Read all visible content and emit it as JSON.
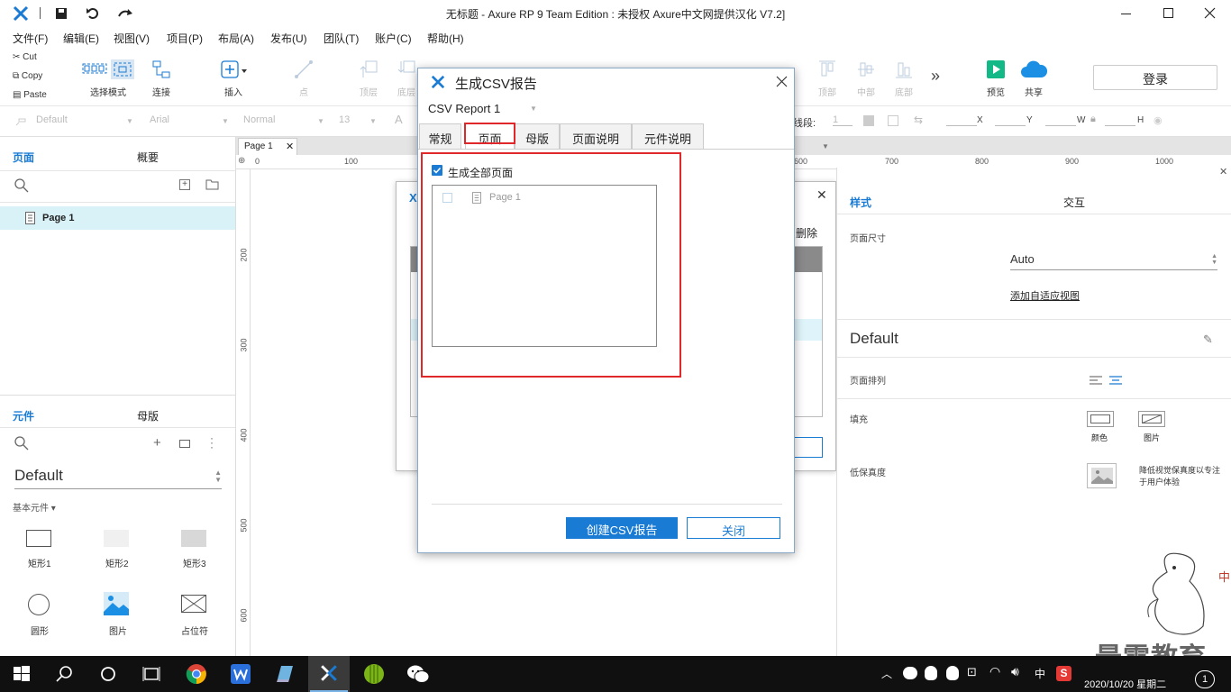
{
  "window": {
    "title": "无标题 - Axure RP 9 Team Edition : 未授权    Axure中文网提供汉化 V7.2]"
  },
  "menu": [
    "文件(F)",
    "编辑(E)",
    "视图(V)",
    "项目(P)",
    "布局(A)",
    "发布(U)",
    "团队(T)",
    "账户(C)",
    "帮助(H)"
  ],
  "clipboard": {
    "cut": "Cut",
    "copy": "Copy",
    "paste": "Paste"
  },
  "toolbar": {
    "select_mode": "选择模式",
    "connect": "连接",
    "insert": "插入",
    "point": "点",
    "top_layer": "顶层",
    "bottom_layer": "底层",
    "align_top": "顶部",
    "align_middle": "中部",
    "align_bottom": "底部",
    "more": "»",
    "preview": "预览",
    "share": "共享",
    "login": "登录"
  },
  "stylebar": {
    "style": "Default",
    "font": "Arial",
    "weight": "Normal",
    "size": "13",
    "line_label": "线段:",
    "line_value": "1",
    "x": "X",
    "y": "Y",
    "w": "W",
    "h": "H"
  },
  "pages_panel": {
    "tab_pages": "页面",
    "tab_outline": "概要",
    "page1": "Page 1"
  },
  "widgets_panel": {
    "tab_widgets": "元件",
    "tab_masters": "母版",
    "library": "Default",
    "category": "基本元件 ▾",
    "items": [
      "矩形1",
      "矩形2",
      "矩形3",
      "圆形",
      "图片",
      "占位符"
    ]
  },
  "canvas": {
    "page_tab": "Page 1",
    "ruler_top": [
      "0",
      "100",
      "600",
      "700",
      "800",
      "900",
      "1000"
    ],
    "ruler_left": [
      "200",
      "300",
      "400",
      "500",
      "600"
    ]
  },
  "bg_dialog": {
    "delete": "删除"
  },
  "right_panel": {
    "tab_style": "样式",
    "tab_interact": "交互",
    "page_size_label": "页面尺寸",
    "page_size_value": "Auto",
    "add_adaptive": "添加自适应视图",
    "style_name": "Default",
    "page_align": "页面排列",
    "fill": "填充",
    "fill_color": "颜色",
    "fill_image": "图片",
    "low_fidelity": "低保真度",
    "low_fidelity_desc": "降低视觉保真度以专注于用户体验"
  },
  "dialog": {
    "title": "生成CSV报告",
    "report_name": "CSV Report 1",
    "tabs": [
      "常规",
      "页面",
      "母版",
      "页面说明",
      "元件说明"
    ],
    "active_tab": 1,
    "gen_all_pages": "生成全部页面",
    "page_item": "Page 1",
    "create_btn": "创建CSV报告",
    "close_btn": "关闭"
  },
  "taskbar": {
    "lang": "中",
    "datetime": "2020/10/20 星期二",
    "notif": "1"
  },
  "watermark": {
    "brand": "最需教育",
    "vertical": "中"
  },
  "colors": {
    "accent": "#1a7bd4",
    "dialog_btn": "#1a7bd4",
    "highlight": "#e0282a",
    "taskbar": "#101010"
  }
}
